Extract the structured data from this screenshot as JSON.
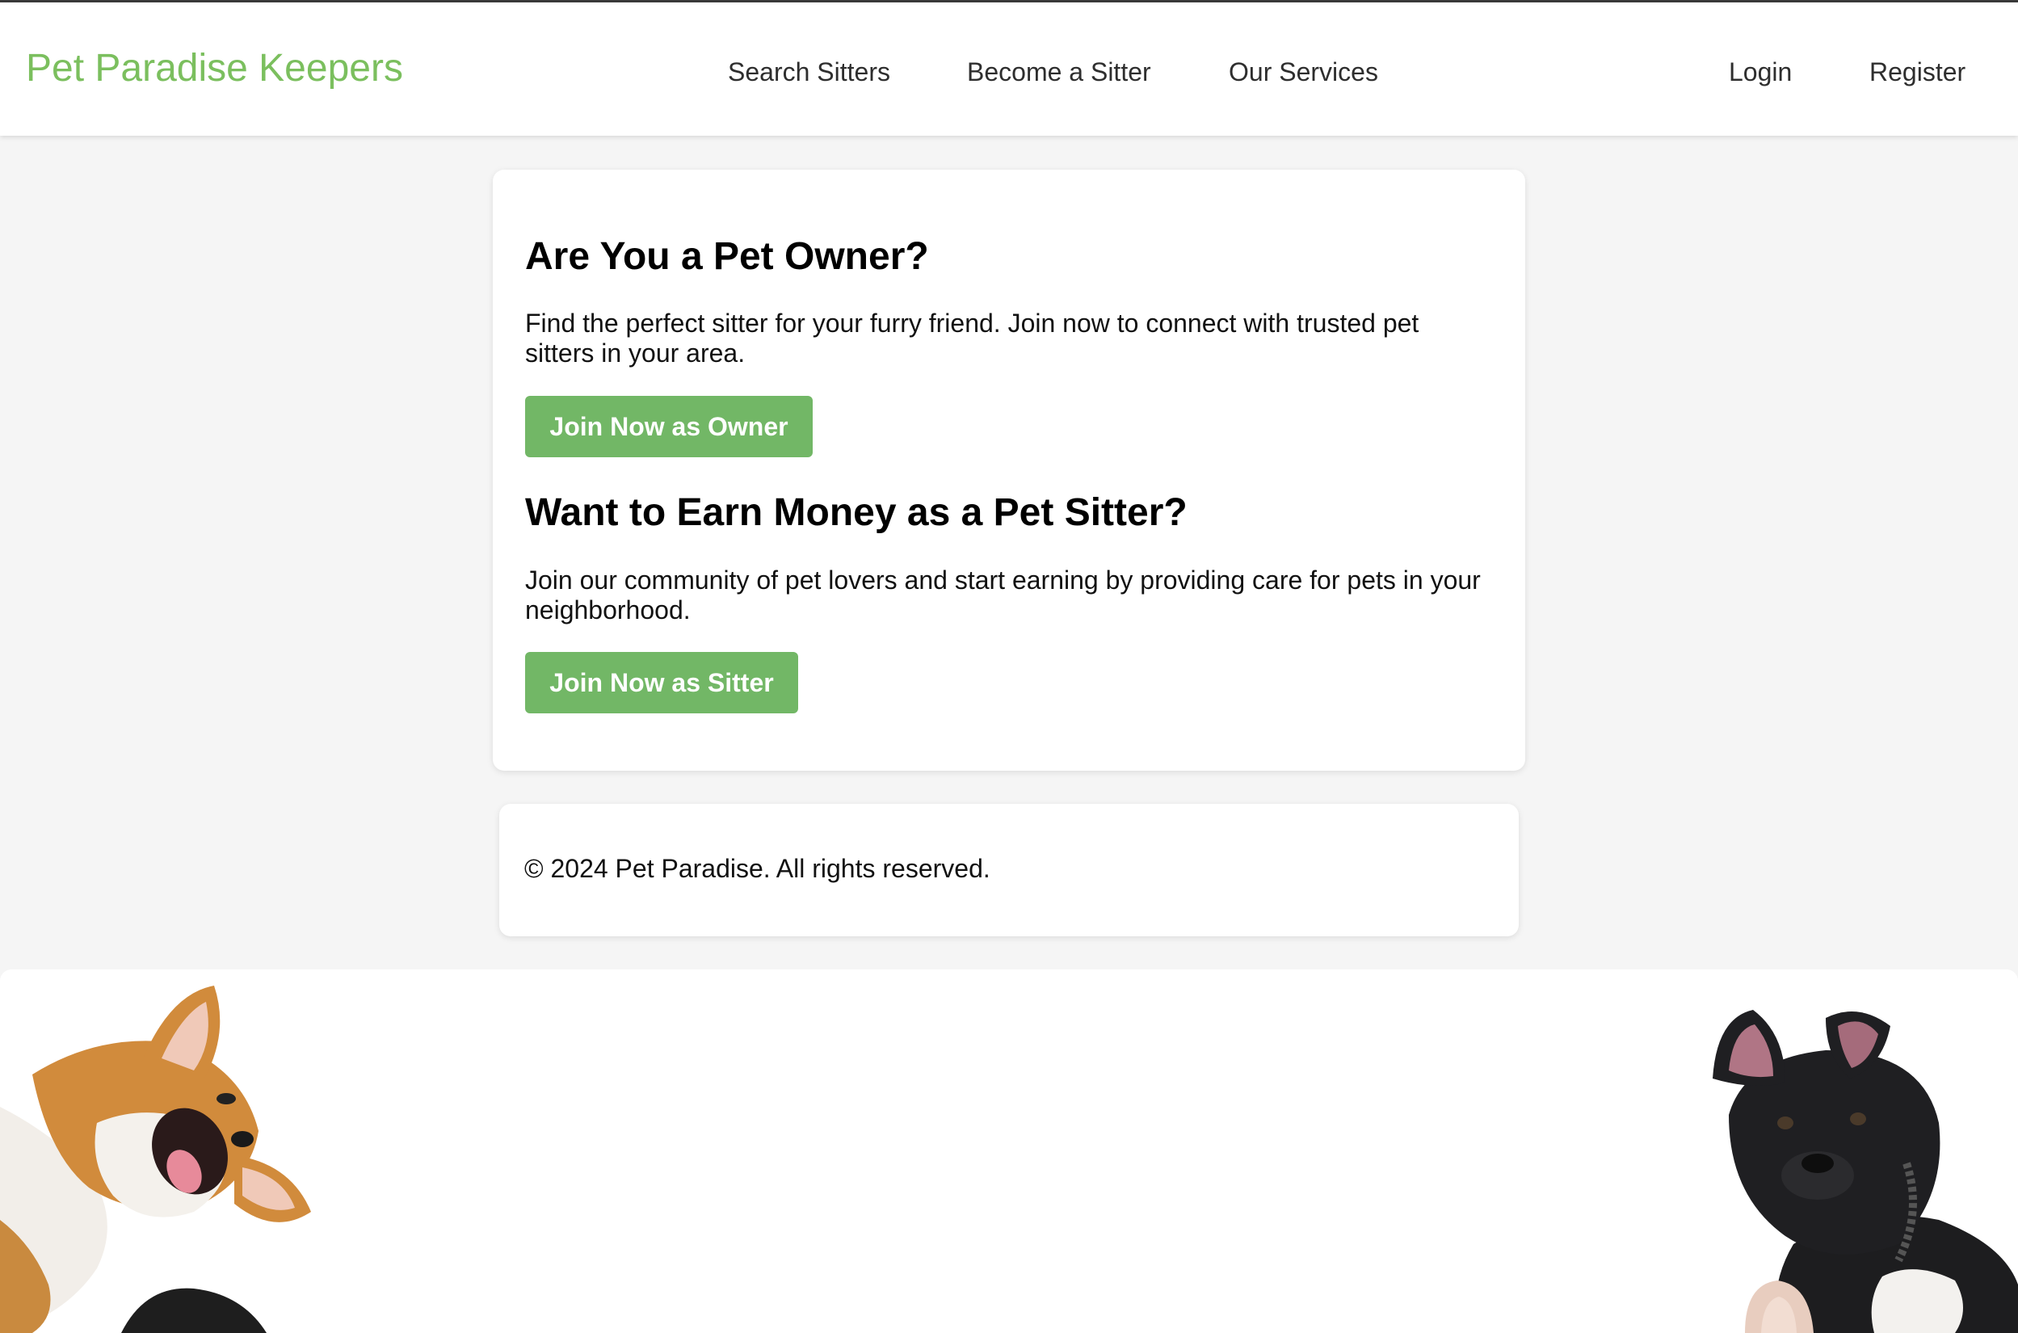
{
  "header": {
    "logo": "Pet Paradise Keepers",
    "nav": {
      "search_sitters": "Search Sitters",
      "become_sitter": "Become a Sitter",
      "our_services": "Our Services",
      "login": "Login",
      "register": "Register"
    }
  },
  "main": {
    "owner": {
      "heading": "Are You a Pet Owner?",
      "text": "Find the perfect sitter for your furry friend. Join now to connect with trusted pet sitters in your area.",
      "button": "Join Now as Owner"
    },
    "sitter": {
      "heading": "Want to Earn Money as a Pet Sitter?",
      "text": "Join our community of pet lovers and start earning by providing care for pets in your neighborhood.",
      "button": "Join Now as Sitter"
    }
  },
  "footer": {
    "copyright": "© 2024 Pet Paradise. All rights reserved."
  },
  "colors": {
    "brand": "#7bbf5e",
    "button": "#72b766",
    "background": "#f5f5f5"
  }
}
